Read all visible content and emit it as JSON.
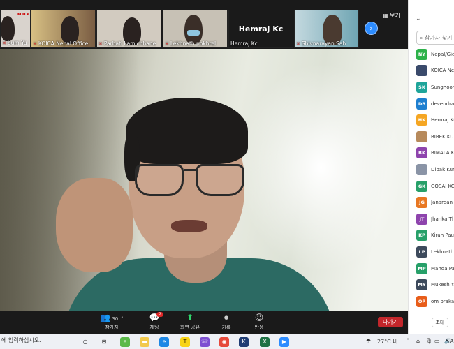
{
  "view_button": "보기",
  "thumbnails": [
    {
      "name": "bum Yu 주...",
      "bg": "#d9d3cd"
    },
    {
      "name": "KOICA Nepal Office",
      "bg": "#a7896c"
    },
    {
      "name": "Parbati Lamichhane",
      "bg": "#cfc8bd"
    },
    {
      "name": "Lekhnath pokhrel",
      "bg": "#c7c1b5"
    },
    {
      "name": "Hemraj Kc",
      "bg": "#1a1a1a"
    },
    {
      "name": "Shivnarayan Sah",
      "bg": "#9fc1c9"
    }
  ],
  "active_speaker_name": "Hemraj Kc",
  "toolbar": {
    "participants_label": "참가자",
    "participants_count": "30",
    "chat_label": "채팅",
    "chat_badge": "2",
    "share_label": "화면 공유",
    "record_label": "기록",
    "reactions_label": "반응",
    "leave_label": "나가기"
  },
  "panel": {
    "search_placeholder": "참가자 찾기",
    "invite_label": "초대",
    "participants": [
      {
        "initials": "NY",
        "name": "Nepal/Gie",
        "color": "#2db24a"
      },
      {
        "initials": "",
        "name": "KOICA Ne",
        "color": "#3a4a6b"
      },
      {
        "initials": "SK",
        "name": "Sunghoon",
        "color": "#1fa59a"
      },
      {
        "initials": "DB",
        "name": "devendra",
        "color": "#1e7fd0"
      },
      {
        "initials": "HK",
        "name": "Hemraj Kc",
        "color": "#f5a623"
      },
      {
        "initials": "",
        "name": "BIBEK KUM",
        "color": "#b78a5c"
      },
      {
        "initials": "BK",
        "name": "BIMALA K",
        "color": "#8e44ad"
      },
      {
        "initials": "",
        "name": "Dipak Kum",
        "color": "#8a94a6"
      },
      {
        "initials": "GK",
        "name": "GOSAI KC",
        "color": "#27a069"
      },
      {
        "initials": "JG",
        "name": "Janardan G",
        "color": "#e87722"
      },
      {
        "initials": "JT",
        "name": "Jhanka Th",
        "color": "#8e44ad"
      },
      {
        "initials": "KP",
        "name": "Kiran Paud",
        "color": "#27a069"
      },
      {
        "initials": "LP",
        "name": "Lekhnath p",
        "color": "#3d4a5c"
      },
      {
        "initials": "MP",
        "name": "Manda Pa",
        "color": "#27a069"
      },
      {
        "initials": "MY",
        "name": "Mukesh Ya",
        "color": "#3d4a5c"
      },
      {
        "initials": "OP",
        "name": "om prakas",
        "color": "#e85d1a"
      }
    ]
  },
  "taskbar": {
    "search_text": "에 입력하십시오.",
    "temperature": "27°C 비",
    "lang": "A"
  }
}
